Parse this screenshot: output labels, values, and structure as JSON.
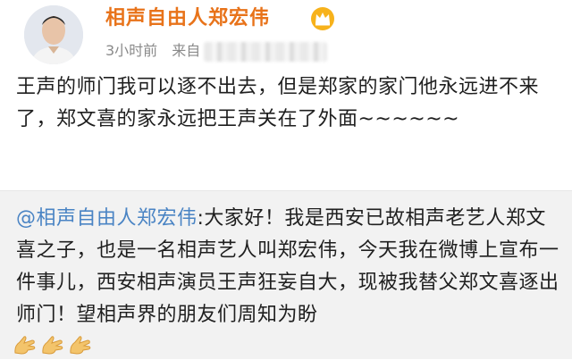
{
  "post": {
    "author": "相声自由人郑宏伟",
    "time": "3小时前",
    "source_label": "来自",
    "text": "王声的师门我可以逐不出去，但是郑家的家门他永远进不来了，郑文喜的家永远把王声关在了外面~~~~~~"
  },
  "quote": {
    "mention": "@相声自由人郑宏伟",
    "text": ":大家好！我是西安已故相声老艺人郑文喜之子，也是一名相声艺人叫郑宏伟，今天我在微博上宣布一件事儿，西安相声演员王声狂妄自大，现被我替父郑文喜逐出师门！望相声界的朋友们周知为盼"
  },
  "icons": {
    "crown": "crown-badge-icon",
    "emoji": "folded-hands-icon"
  },
  "colors": {
    "author": "#e8731a",
    "mention": "#4a84c4",
    "quote_bg": "#f2f2f2"
  }
}
